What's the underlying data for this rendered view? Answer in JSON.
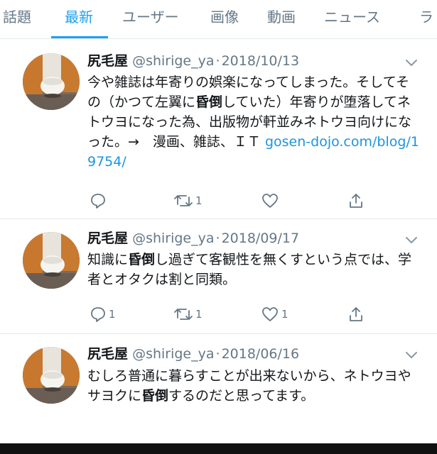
{
  "tabs": [
    "話題",
    "最新",
    "ユーザー",
    "画像",
    "動画",
    "ニュース",
    "ラ"
  ],
  "active_tab": 1,
  "accent_color": "#1da1f2",
  "link_color": "#1b95e0",
  "tweets": [
    {
      "author_name": "尻毛屋",
      "handle": "@shirige_ya",
      "date": "2018/10/13",
      "text_segments": [
        {
          "text": "今や雑誌は年寄りの娯楽になってしまった。そしてその（かつて左翼に",
          "style": "normal"
        },
        {
          "text": "昏倒",
          "style": "bold"
        },
        {
          "text": "していた）年寄りが堕落してネトウヨになった為、出版物が軒並みネトウヨ向けになった。→　漫画、雑誌、ＩＴ ",
          "style": "normal"
        },
        {
          "text": "gosen-dojo.com/blog/19754/",
          "style": "link"
        }
      ],
      "reply_count": "",
      "retweet_count": "1",
      "like_count": "",
      "icons": [
        "reply-icon",
        "retweet-icon",
        "like-icon",
        "share-icon"
      ]
    },
    {
      "author_name": "尻毛屋",
      "handle": "@shirige_ya",
      "date": "2018/09/17",
      "text_segments": [
        {
          "text": "知識に",
          "style": "normal"
        },
        {
          "text": "昏倒",
          "style": "bold"
        },
        {
          "text": "し過ぎて客観性を無くすという点では、学者とオタクは割と同類。",
          "style": "normal"
        }
      ],
      "reply_count": "1",
      "retweet_count": "1",
      "like_count": "1",
      "icons": [
        "reply-icon",
        "retweet-icon",
        "like-icon",
        "share-icon"
      ]
    },
    {
      "author_name": "尻毛屋",
      "handle": "@shirige_ya",
      "date": "2018/06/16",
      "text_segments": [
        {
          "text": "むしろ普通に暮らすことが出来ないから、ネトウヨやサヨクに",
          "style": "normal"
        },
        {
          "text": "昏倒",
          "style": "bold"
        },
        {
          "text": "するのだと思ってます。",
          "style": "normal"
        }
      ],
      "icons": [
        "chevron-down-icon"
      ]
    }
  ]
}
